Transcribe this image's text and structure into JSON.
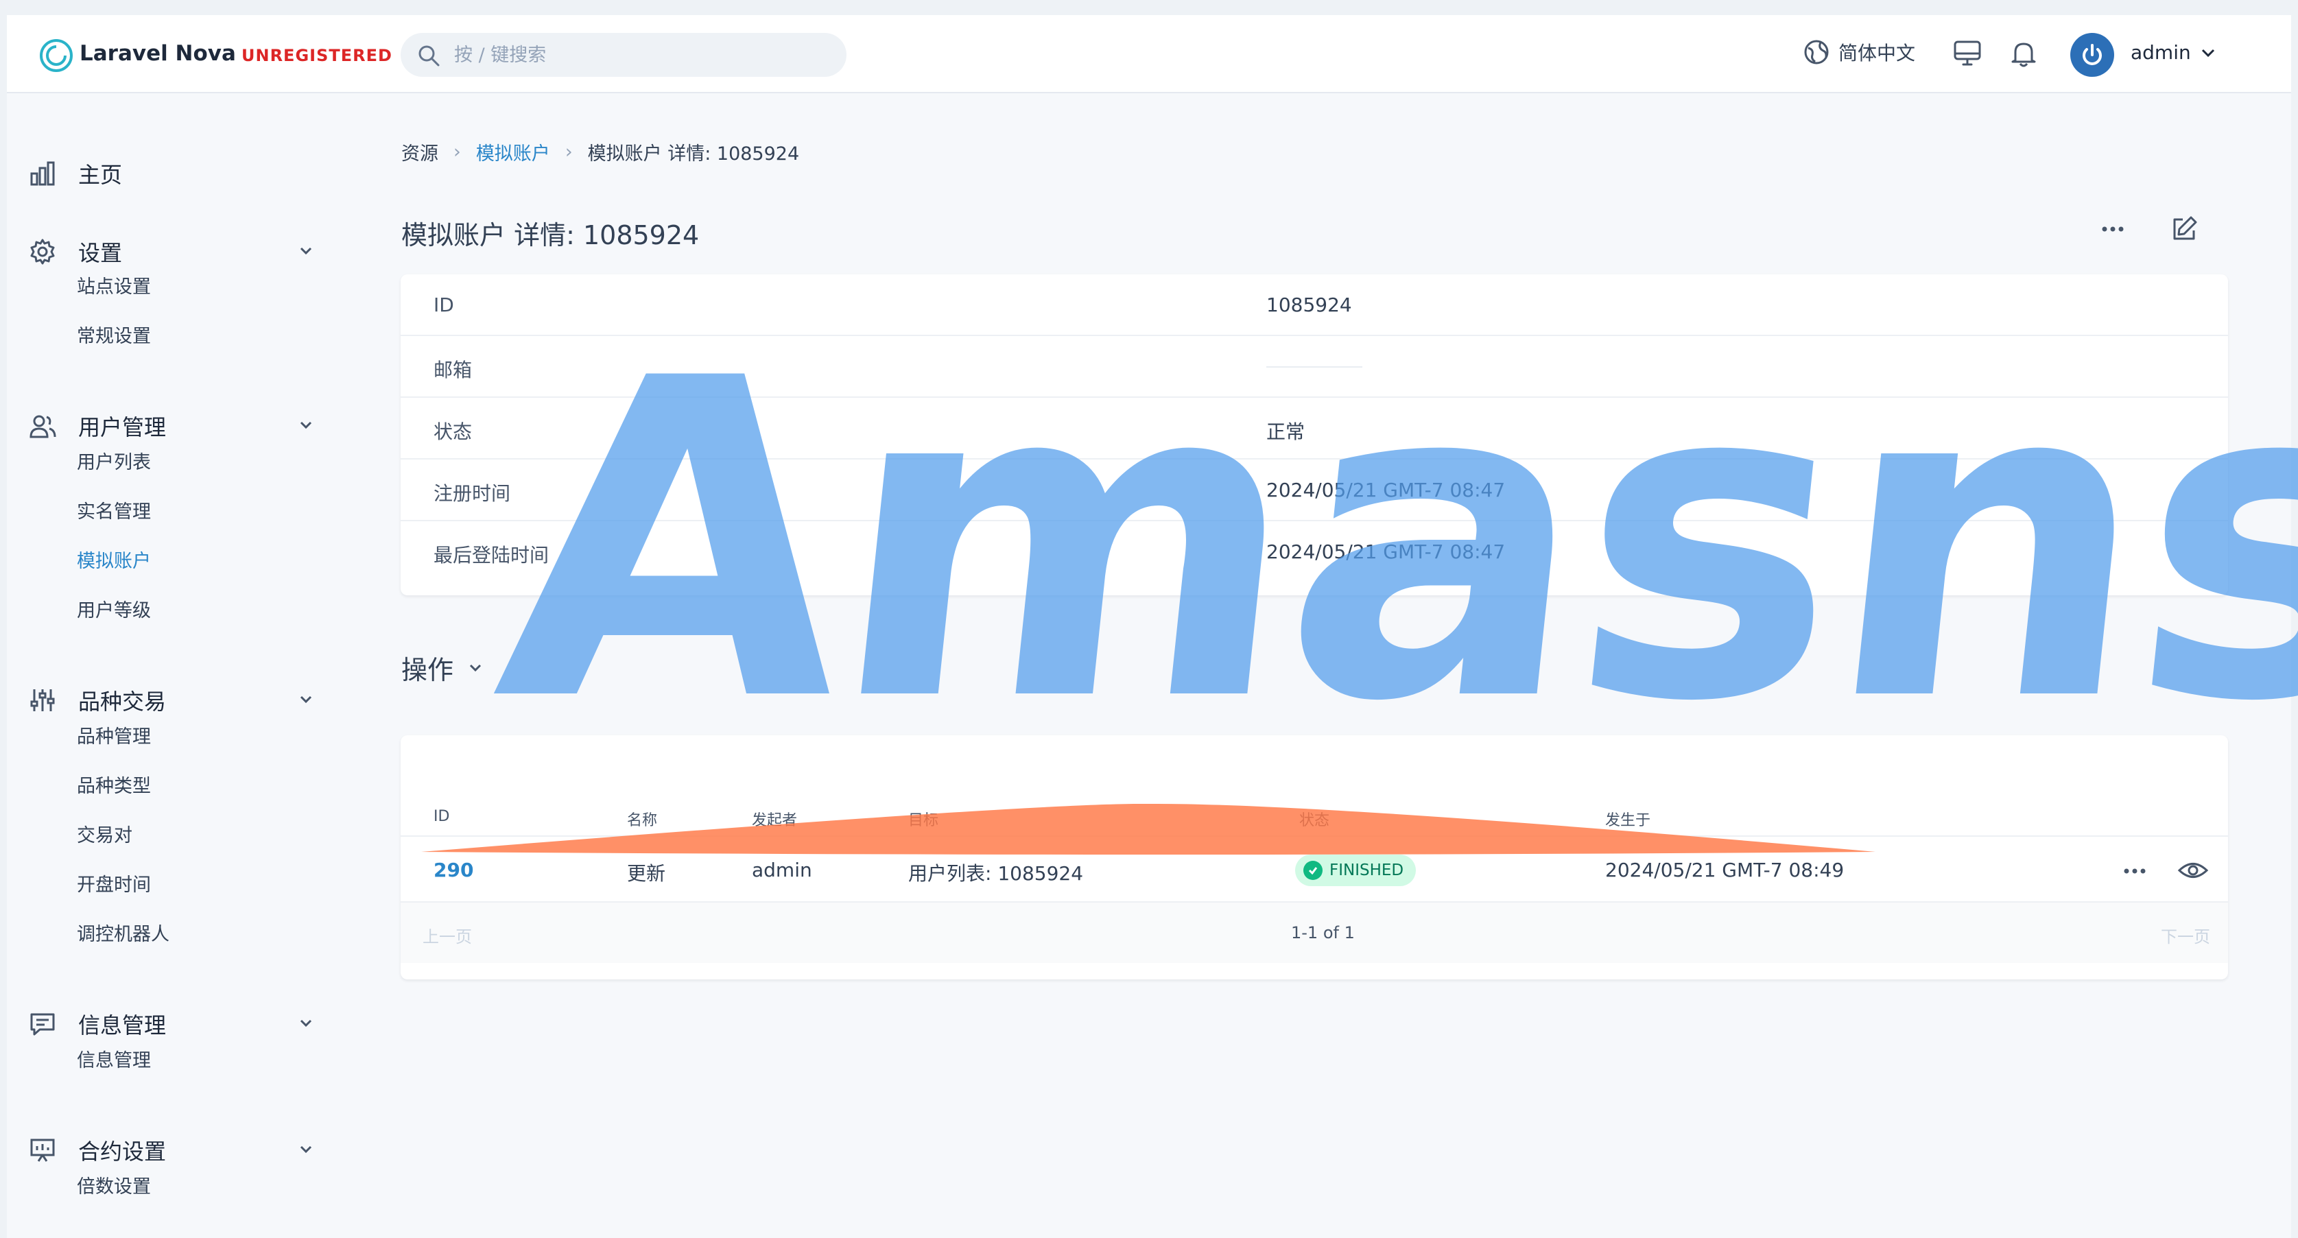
{
  "header": {
    "brand": "Laravel Nova",
    "badge": "UNREGISTERED",
    "search_placeholder": "按 / 键搜索",
    "language": "简体中文",
    "user": "admin"
  },
  "sidebar": {
    "home": "主页",
    "settings": {
      "label": "设置",
      "items": [
        "站点设置",
        "常规设置"
      ]
    },
    "users": {
      "label": "用户管理",
      "items": [
        "用户列表",
        "实名管理",
        "模拟账户",
        "用户等级"
      ]
    },
    "trading": {
      "label": "品种交易",
      "items": [
        "品种管理",
        "品种类型",
        "交易对",
        "开盘时间",
        "调控机器人"
      ]
    },
    "messages": {
      "label": "信息管理",
      "items": [
        "信息管理"
      ]
    },
    "contracts": {
      "label": "合约设置",
      "items": [
        "倍数设置"
      ]
    }
  },
  "breadcrumb": [
    "资源",
    "模拟账户",
    "模拟账户 详情: 1085924"
  ],
  "page_title": "模拟账户 详情: 1085924",
  "details": [
    {
      "key": "ID",
      "value": "1085924"
    },
    {
      "key": "邮箱",
      "value": ""
    },
    {
      "key": "状态",
      "value": "正常"
    },
    {
      "key": "注册时间",
      "value": "2024/05/21 GMT-7 08:47"
    },
    {
      "key": "最后登陆时间",
      "value": "2024/05/21 GMT-7 08:47"
    }
  ],
  "actions_section": {
    "title": "操作",
    "columns": [
      "ID",
      "名称",
      "发起者",
      "目标",
      "状态",
      "发生于"
    ],
    "rows": [
      {
        "id": "290",
        "name": "更新",
        "initiator": "admin",
        "target": "用户列表: 1085924",
        "status": "FINISHED",
        "time": "2024/05/21 GMT-7 08:49"
      }
    ],
    "prev": "上一页",
    "page_info": "1-1 of 1",
    "next": "下一页"
  },
  "watermark": "Amasns",
  "colors": {
    "accent": "#2a86c9",
    "danger": "#dc2626",
    "success": "#10b981",
    "watermark": "#529deb"
  }
}
